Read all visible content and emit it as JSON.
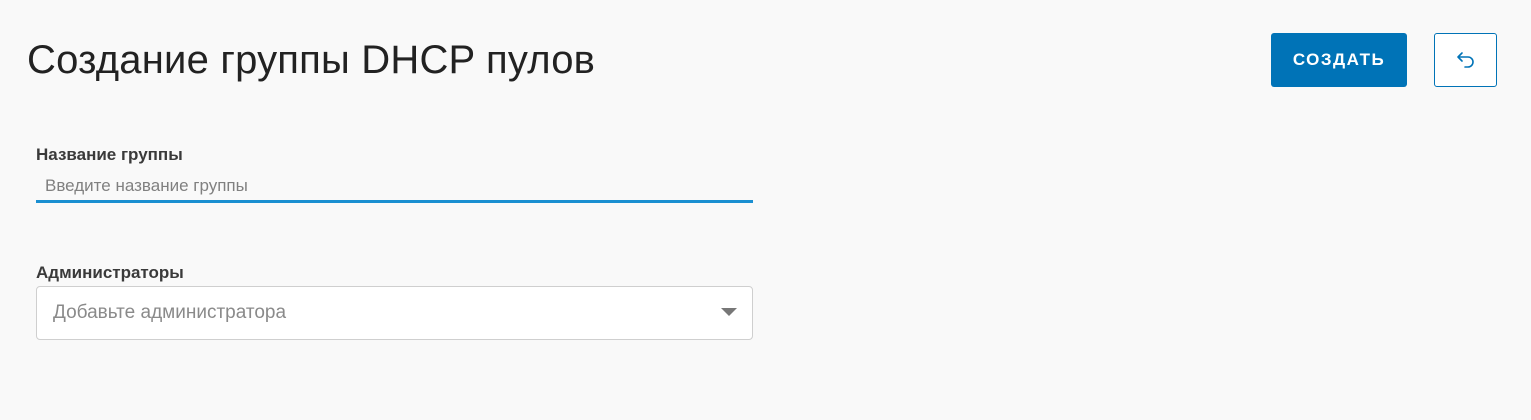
{
  "header": {
    "title": "Создание группы DHCP пулов",
    "create_label": "СОЗДАТЬ",
    "back_icon": "undo-arrow-icon"
  },
  "form": {
    "group_name": {
      "label": "Название группы",
      "placeholder": "Введите название группы",
      "value": ""
    },
    "administrators": {
      "label": "Администраторы",
      "placeholder": "Добавьте администратора"
    }
  },
  "colors": {
    "accent": "#0073b7",
    "input_underline": "#1a8fd1",
    "background": "#f9f9f9"
  }
}
